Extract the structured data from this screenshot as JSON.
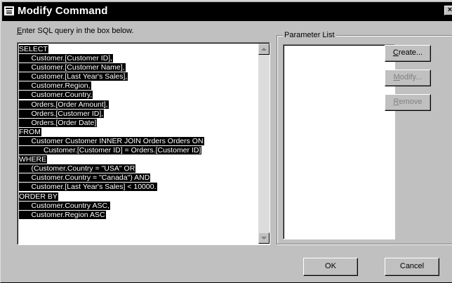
{
  "window": {
    "title": "Modify Command",
    "close_glyph": "×"
  },
  "instruction": {
    "accel": "E",
    "rest": "nter SQL query in the box below."
  },
  "sql": {
    "lines": [
      "SELECT",
      "      Customer.[Customer ID],",
      "      Customer.[Customer Name],",
      "      Customer.[Last Year's Sales],",
      "      Customer.Region,",
      "      Customer.Country,",
      "      Orders.[Order Amount],",
      "      Orders.[Customer ID],",
      "      Orders.[Order Date]",
      "FROM",
      "      Customer Customer INNER JOIN Orders Orders ON",
      "            Customer.[Customer ID] = Orders.[Customer ID]",
      "WHERE",
      "      (Customer.Country = \"USA\" OR",
      "      Customer.Country = \"Canada\") AND",
      "      Customer.[Last Year's Sales] < 10000.",
      "ORDER BY",
      "      Customer.Country ASC,",
      "      Customer.Region ASC"
    ]
  },
  "parameters": {
    "label": "Parameter List",
    "items": []
  },
  "buttons": {
    "create": {
      "accel": "C",
      "rest": "reate..."
    },
    "modify": {
      "accel": "M",
      "rest": "odify..."
    },
    "remove": {
      "accel": "R",
      "rest": "emove"
    },
    "ok": "OK",
    "cancel": "Cancel"
  },
  "icons": {
    "system_menu": "window-menu-icon",
    "close": "close-icon",
    "scroll_up": "scroll-up-arrow-icon",
    "scroll_down": "scroll-down-arrow-icon"
  }
}
